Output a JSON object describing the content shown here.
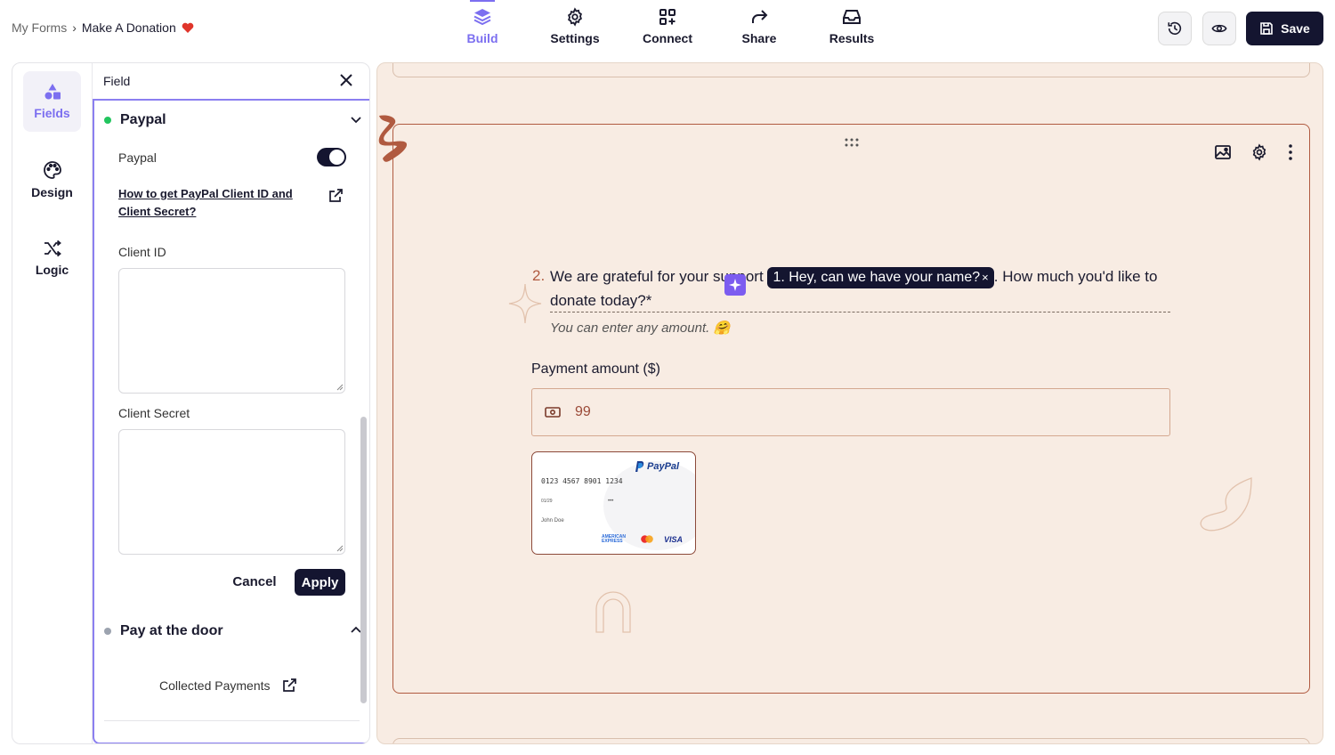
{
  "breadcrumb": {
    "parent": "My Forms",
    "separator": "›",
    "current": "Make A Donation",
    "heart_icon": "heart-icon"
  },
  "nav": {
    "tabs": [
      {
        "label": "Build",
        "icon": "layers-icon",
        "active": true
      },
      {
        "label": "Settings",
        "icon": "gear-icon",
        "active": false
      },
      {
        "label": "Connect",
        "icon": "grid-plus-icon",
        "active": false
      },
      {
        "label": "Share",
        "icon": "share-arrow-icon",
        "active": false
      },
      {
        "label": "Results",
        "icon": "inbox-icon",
        "active": false
      }
    ],
    "accent": "#7c6ff0"
  },
  "toolbar": {
    "history_icon": "history-icon",
    "preview_icon": "eye-icon",
    "save_label": "Save"
  },
  "rail": {
    "items": [
      {
        "label": "Fields",
        "icon": "shapes-icon",
        "active": true
      },
      {
        "label": "Design",
        "icon": "palette-icon",
        "active": false
      },
      {
        "label": "Logic",
        "icon": "shuffle-icon",
        "active": false
      }
    ]
  },
  "field_panel": {
    "title": "Field",
    "paypal": {
      "heading": "Paypal",
      "status_color": "#22c55e",
      "toggle_label": "Paypal",
      "toggle_on": true,
      "help_link": "How to get PayPal Client ID and Client Secret?",
      "client_id_label": "Client ID",
      "client_id_value": "",
      "client_secret_label": "Client Secret",
      "client_secret_value": "",
      "cancel_label": "Cancel",
      "apply_label": "Apply"
    },
    "pay_at_door": {
      "heading": "Pay at the door",
      "status_color": "#9ca3af",
      "collected_label": "Collected Payments"
    }
  },
  "canvas": {
    "question_number": "2.",
    "question_before": "We are grateful for your support",
    "recall_pill": "1. Hey, can we have your name?",
    "question_after": ". How much you'd like to donate today?*",
    "hint": "You can enter any amount. 🤗",
    "payment_label": "Payment amount ($)",
    "payment_value": "99",
    "card": {
      "brand": "PayPal",
      "number": "0123 4567 8901 1234",
      "expiry": "01/29",
      "cvv": "•••",
      "holder": "John Doe",
      "logos": [
        "AMERICAN EXPRESS",
        "VISA"
      ]
    },
    "colors": {
      "background": "#f8ece3",
      "accent": "#b05a40"
    }
  }
}
